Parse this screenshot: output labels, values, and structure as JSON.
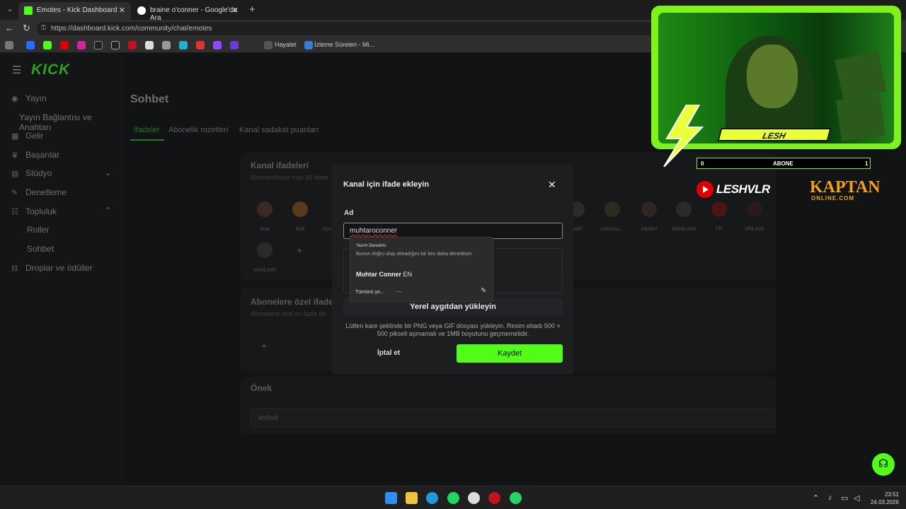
{
  "browser": {
    "tabs": [
      {
        "title": "Emotes - Kick Dashboard",
        "active": true,
        "favicon_color": "#53fc18"
      },
      {
        "title": "braine o'conner - Google'da Ara",
        "active": false,
        "favicon_color": "#ffffff"
      }
    ],
    "url": "https://dashboard.kick.com/community/chat/emotes",
    "bookmarks": [
      "Hayalet",
      "İzleme Süreleri - Mi..."
    ]
  },
  "sidebar": {
    "logo": "KICK",
    "items": [
      {
        "label": "Yayın",
        "icon": "broadcast-icon"
      },
      {
        "label": "Yayın Bağlantısı ve Anahtarı"
      },
      {
        "label": "Gelir",
        "icon": "revenue-icon"
      },
      {
        "label": "Başarılar",
        "icon": "trophy-icon"
      },
      {
        "label": "Stüdyo",
        "icon": "studio-icon"
      },
      {
        "label": "Denetleme",
        "icon": "wrench-icon"
      },
      {
        "label": "Topluluk",
        "icon": "community-icon"
      },
      {
        "label": "Roller"
      },
      {
        "label": "Sohbet"
      },
      {
        "label": "Droplar ve ödüller",
        "icon": "drops-icon"
      }
    ]
  },
  "main": {
    "title": "Sohbet",
    "tabs": [
      "İfadeler",
      "Abonelik rozetleri",
      "Kanal sadakat puanları"
    ],
    "channel_emotes_title": "Kanal ifadeleri",
    "channel_emotes_sub": "Eklenebilecek max 80 ifade",
    "emote_labels": [
      "boa",
      "bok",
      "oyu",
      "NaH",
      "sabunu...",
      "saskin",
      "advaLesh",
      "TR",
      "VALesh",
      "vetoLesh"
    ],
    "sub_emotes_title": "Abonelere özel ifade",
    "sub_emotes_sub": "Abonelere özel en fazla 80",
    "prefix_title": "Önek",
    "prefix_value": "leshvlr"
  },
  "modal": {
    "title": "Kanal için ifade ekleyin",
    "name_label": "Ad",
    "name_value_pre": "muhtar",
    "name_value_post": "oconner",
    "upload_label": "Yerel aygıtdan yükleyin",
    "help_text": "Lütfen kare şeklinde bir PNG veya GIF dosyası yükleyin. Resim ebadı 500 × 500 pikseli aşmamalı ve 1MB boyutunu geçmemelidir.",
    "cancel_label": "İptal et",
    "save_label": "Kaydet"
  },
  "spellcheck": {
    "heading": "Yazım Denetimi",
    "description": "Bunun doğru olup olmadığını bir kez daha denetleyin",
    "suggestion": "Muhtar Conner",
    "lang": "EN",
    "ignore_all": "Tümünü yo...",
    "more": "···"
  },
  "overlay": {
    "cam_name": "LESH",
    "sub_left": "0",
    "sub_label": "ABONE",
    "sub_right": "1",
    "yt_name": "LESHVLR",
    "sponsor": "KAPTAN",
    "sponsor_sub": "ONLINE.COM"
  },
  "taskbar": {
    "time": "23:51",
    "date": "24.03.2026"
  },
  "colors": {
    "kick_green": "#53fc18",
    "overlay_green": "#7ef21a"
  }
}
